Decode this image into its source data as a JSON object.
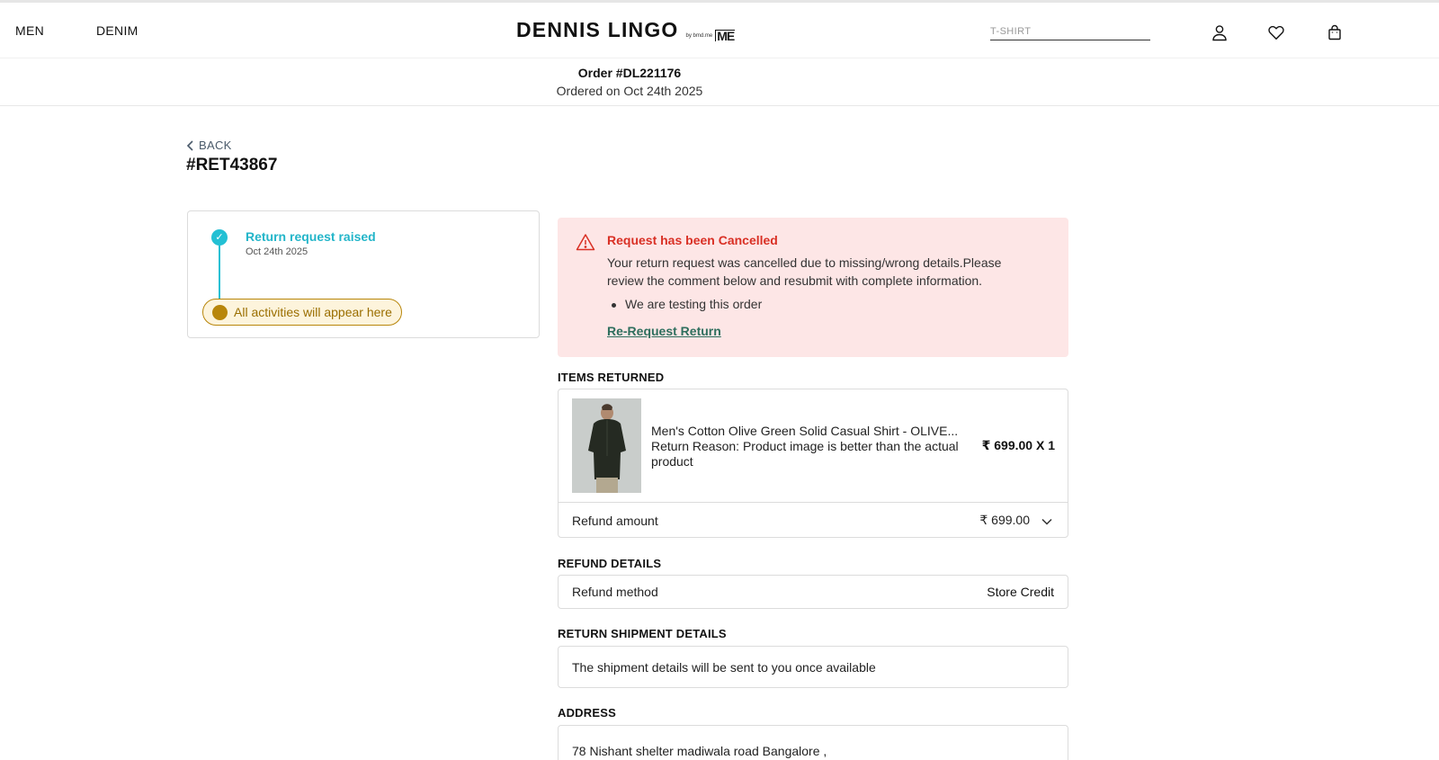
{
  "header": {
    "nav": [
      {
        "label": "MEN"
      },
      {
        "label": "DENIM"
      }
    ],
    "brand": {
      "name": "DENNIS LINGO",
      "by": "by bmd.me",
      "mark": "ME"
    },
    "search": {
      "placeholder": "T-SHIRT"
    },
    "icons": [
      "user-icon",
      "heart-icon",
      "bag-icon"
    ]
  },
  "order": {
    "number": "Order #DL221176",
    "date": "Ordered on Oct 24th 2025"
  },
  "back_label": "BACK",
  "return_id": "#RET43867",
  "timeline": {
    "event_title": "Return request raised",
    "event_date": "Oct 24th 2025",
    "check": "✓",
    "activities_note": "All activities will appear here"
  },
  "alert": {
    "title": "Request has been Cancelled",
    "message": "Your return request was cancelled due to missing/wrong details.Please review the comment below and resubmit with complete information.",
    "comment": "We are testing this order",
    "action_label": "Re-Request Return"
  },
  "items_returned": {
    "section_label": "ITEMS RETURNED",
    "product_title": "Men's Cotton Olive Green Solid Casual Shirt - OLIVE...",
    "return_reason": "Return Reason: Product image is better than the actual product",
    "price_qty": "₹ 699.00 X 1",
    "refund_amount_label": "Refund amount",
    "refund_amount_value": "₹ 699.00"
  },
  "refund_details": {
    "section_label": "REFUND DETAILS",
    "method_label": "Refund method",
    "method_value": "Store Credit"
  },
  "shipment": {
    "section_label": "RETURN SHIPMENT DETAILS",
    "text": "The shipment details will be sent to you once available"
  },
  "address": {
    "section_label": "ADDRESS",
    "line1": "78 Nishant shelter madiwala road Bangalore ,"
  },
  "colors": {
    "accent_teal": "#23c0d4",
    "alert_bg": "#fde6e6",
    "alert_red": "#d93025",
    "pill_gold": "#b8860b"
  }
}
